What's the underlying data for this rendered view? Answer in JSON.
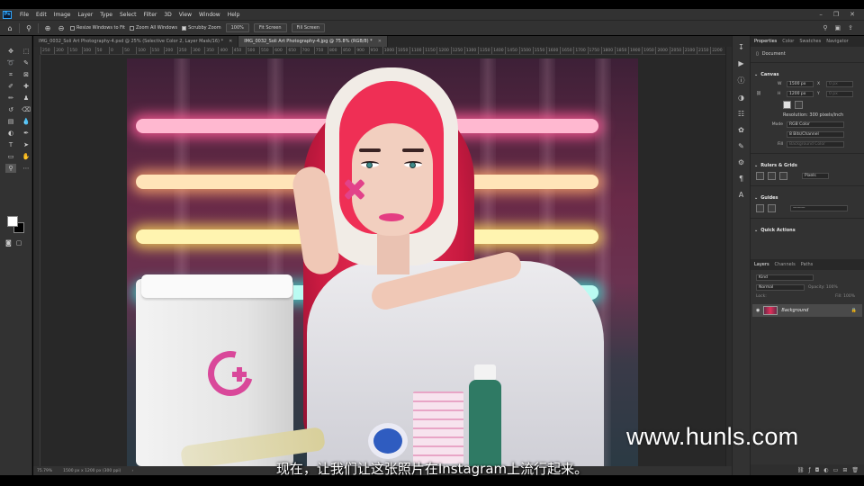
{
  "menu": {
    "logo": "Ps",
    "items": [
      "File",
      "Edit",
      "Image",
      "Layer",
      "Type",
      "Select",
      "Filter",
      "3D",
      "View",
      "Window",
      "Help"
    ]
  },
  "options": {
    "resize_windows": "Resize Windows to Fit",
    "zoom_all": "Zoom All Windows",
    "scrubby_zoom": "Scrubby Zoom",
    "zoom_value": "100%",
    "fit_screen": "Fit Screen",
    "fill_screen": "Fill Screen"
  },
  "tabs": [
    {
      "label": "IMG_0032_Soli Art Photography-4.psd @ 25% (Selective Color 2, Layer Mask/16) *"
    },
    {
      "label": "IMG_0032_Soli Art Photography-4.jpg @ 75.8% (RGB/8) *"
    }
  ],
  "ruler": [
    "250",
    "200",
    "150",
    "100",
    "50",
    "0",
    "50",
    "100",
    "150",
    "200",
    "250",
    "300",
    "350",
    "400",
    "450",
    "500",
    "550",
    "600",
    "650",
    "700",
    "750",
    "800",
    "850",
    "900",
    "950",
    "1000",
    "1050",
    "1100",
    "1150",
    "1200",
    "1250",
    "1300",
    "1350",
    "1400",
    "1450",
    "1500",
    "1550",
    "1600",
    "1650",
    "1700",
    "1750",
    "1800",
    "1850",
    "1900",
    "1950",
    "2000",
    "2050",
    "2100",
    "2150",
    "2200"
  ],
  "status": {
    "zoom": "75.79%",
    "doc_size": "1500 px x 1200 px (300 ppi)"
  },
  "panel_tabs": [
    "Properties",
    "Color",
    "Swatches",
    "Navigator"
  ],
  "properties": {
    "doc_label": "Document",
    "canvas_title": "Canvas",
    "w_label": "W",
    "w_value": "1500 px",
    "x_label": "X",
    "x_value": "0 px",
    "h_label": "H",
    "h_value": "1200 px",
    "y_label": "Y",
    "y_value": "0 px",
    "resolution": "Resolution: 300 pixels/inch",
    "mode_label": "Mode",
    "mode_value": "RGB Color",
    "depth_value": "8 Bits/Channel",
    "fill_label": "Fill",
    "fill_value": "Background Color",
    "rulers_title": "Rulers & Grids",
    "rulers_unit": "Pixels",
    "guides_title": "Guides",
    "quick_actions": "Quick Actions"
  },
  "layers_tabs": [
    "Layers",
    "Channels",
    "Paths"
  ],
  "layers": {
    "kind_placeholder": "Kind",
    "blend": "Normal",
    "opacity": "Opacity: 100%",
    "lock": "Lock:",
    "fill": "Fill: 100%",
    "items": [
      {
        "name": "Background"
      }
    ]
  },
  "overlay": {
    "watermark": "www.hunls.com",
    "subtitle": "现在，让我们让这张照片在Instagram上流行起来。"
  },
  "colors": {
    "foreground": "#ffffff",
    "background": "#000000",
    "accent": "#31a8ff"
  }
}
